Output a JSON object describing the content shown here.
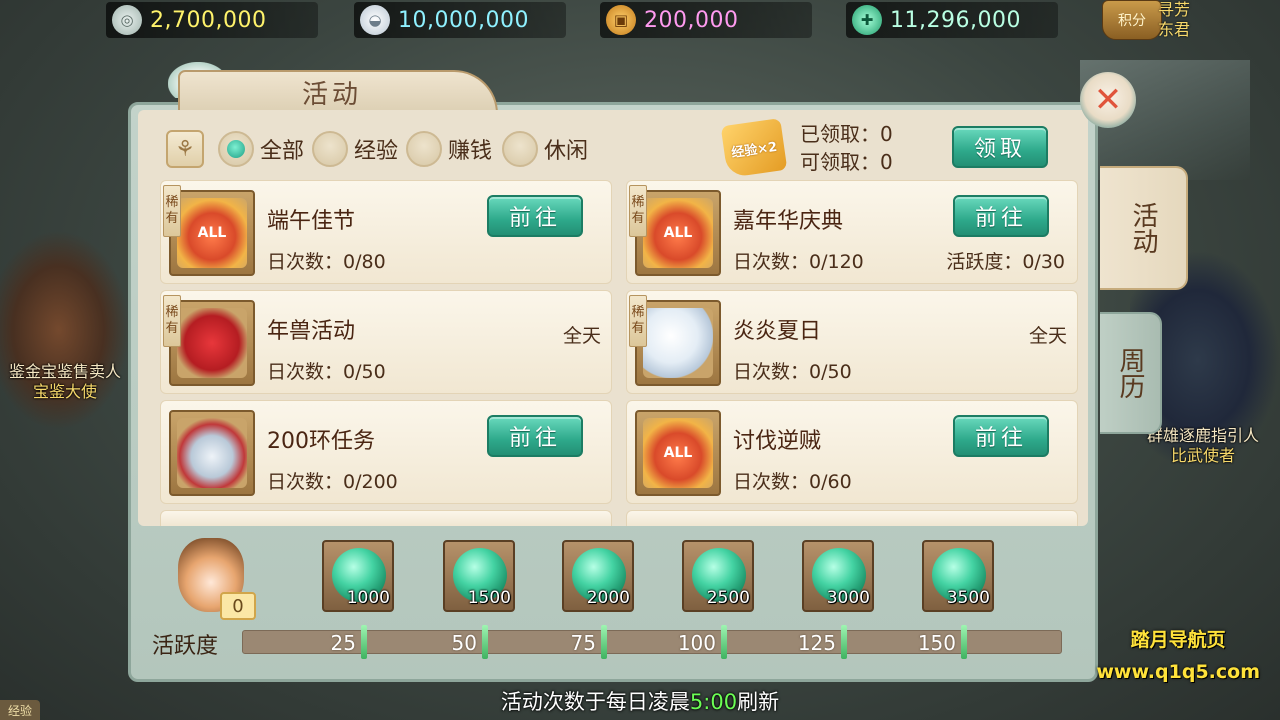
{
  "currencies": [
    {
      "icon": "coin-icon",
      "value": "2,700,000",
      "color": "#fff36b"
    },
    {
      "icon": "silver-ingot-icon",
      "value": "10,000,000",
      "color": "#8ff1ff"
    },
    {
      "icon": "copper-coin-icon",
      "value": "200,000",
      "color": "#ff9bf0"
    },
    {
      "icon": "jade-icon",
      "value": "11,296,000",
      "color": "#b9ffe3"
    }
  ],
  "points_badge": "积分",
  "top_right_npc": {
    "line1": "寻芳",
    "line2": "东君"
  },
  "left_npc": {
    "role": "鉴金宝鉴售卖人",
    "name": "宝鉴大使"
  },
  "right_npc": {
    "role": "群雄逐鹿指引人",
    "name": "比武使者"
  },
  "panel": {
    "title": "活动",
    "filters": [
      {
        "label": "全部",
        "selected": true
      },
      {
        "label": "经验",
        "selected": false
      },
      {
        "label": "赚钱",
        "selected": false
      },
      {
        "label": "休闲",
        "selected": false
      }
    ],
    "exp_badge": "经验×2",
    "claimed": "已领取：0",
    "claimable": "可领取：0",
    "claim_button": "领取",
    "rare_tag": "稀有",
    "activities": [
      {
        "name": "端午佳节",
        "count": "日次数：0/80",
        "button": "前往",
        "rare": true
      },
      {
        "name": "嘉年华庆典",
        "count": "日次数：0/120",
        "extra": "活跃度：0/30",
        "button": "前往",
        "rare": true
      },
      {
        "name": "年兽活动",
        "count": "日次数：0/50",
        "time": "全天",
        "rare": true
      },
      {
        "name": "炎炎夏日",
        "count": "日次数：0/50",
        "time": "全天",
        "rare": true
      },
      {
        "name": "200环任务",
        "count": "日次数：0/200",
        "button": "前往",
        "rare": false
      },
      {
        "name": "讨伐逆贼",
        "count": "日次数：0/60",
        "button": "前往",
        "rare": false
      }
    ],
    "side_tabs": [
      {
        "label": "活动",
        "active": true
      },
      {
        "label": "周历",
        "active": false
      }
    ],
    "current_vitality": "0",
    "rewards": [
      "1000",
      "1500",
      "2000",
      "2500",
      "3000",
      "3500"
    ],
    "vitality_label": "活跃度",
    "vitality_value": 0,
    "vitality_marks": [
      "25",
      "50",
      "75",
      "100",
      "125",
      "150"
    ]
  },
  "footer": {
    "prefix": "活动次数于每日凌晨",
    "time": "5:00",
    "suffix": "刷新"
  },
  "exp_chip": "经验",
  "watermark": {
    "line1": "踏月导航页",
    "line2": "www.q1q5.com"
  }
}
